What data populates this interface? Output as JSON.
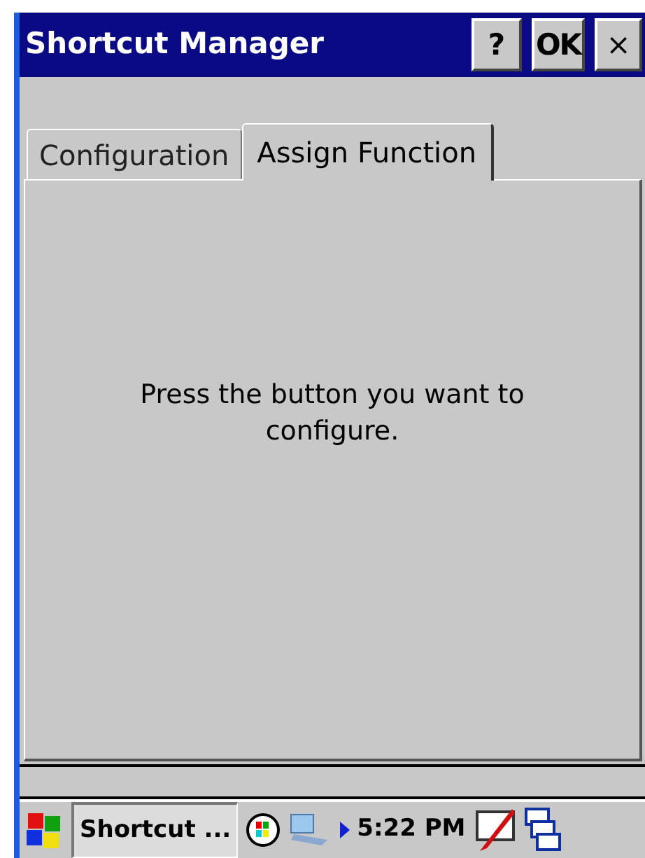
{
  "window": {
    "title": "Shortcut Manager",
    "buttons": [
      {
        "kind": "help",
        "label": "?"
      },
      {
        "kind": "ok",
        "label": "OK"
      },
      {
        "kind": "close",
        "label": "×"
      }
    ]
  },
  "tabs": [
    {
      "label": "Configuration",
      "selected": false
    },
    {
      "label": "Assign Function",
      "selected": true
    }
  ],
  "panel": {
    "message": "Press the button you want to configure."
  },
  "taskbar": {
    "task": "Shortcut ...",
    "time": "5:22 PM"
  }
}
